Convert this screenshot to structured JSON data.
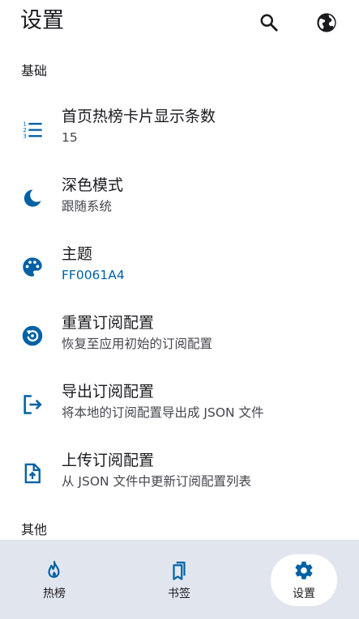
{
  "header": {
    "title": "设置"
  },
  "sections": [
    {
      "label": "基础"
    },
    {
      "label": "其他"
    }
  ],
  "items": [
    {
      "label": "首页热榜卡片显示条数",
      "sub": "15"
    },
    {
      "label": "深色模式",
      "sub": "跟随系统"
    },
    {
      "label": "主题",
      "sub": "FF0061A4"
    },
    {
      "label": "重置订阅配置",
      "sub": "恢复至应用初始的订阅配置"
    },
    {
      "label": "导出订阅配置",
      "sub": "将本地的订阅配置导出成 JSON 文件"
    },
    {
      "label": "上传订阅配置",
      "sub": "从 JSON 文件中更新订阅配置列表"
    }
  ],
  "nav": [
    {
      "label": "热榜"
    },
    {
      "label": "书签"
    },
    {
      "label": "设置"
    }
  ],
  "colors": {
    "accent": "#0061a4",
    "navbar": "#e1e6ee",
    "text": "#1b1b1f"
  }
}
